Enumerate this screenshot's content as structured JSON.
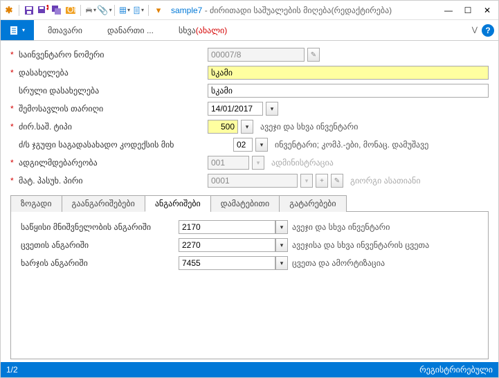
{
  "window": {
    "doc_name": "sample7",
    "title_suffix": " - ძირითადი საშუალების მიღება(რედაქტირება)"
  },
  "menu": {
    "main": "მთავარი",
    "addon": "დანართი ...",
    "other": "სხვა",
    "other_new": "(ახალი)"
  },
  "form": {
    "inv_label": "საინვენტარო ნომერი",
    "inv_value": "00007/8",
    "name_label": "დასახელება",
    "name_value": "სკამი",
    "fullname_label": "სრული დასახელება",
    "fullname_value": "სკამი",
    "date_label": "შემოსავლის თარიღი",
    "date_value": "14/01/2017",
    "type_label": "ძირ.საშ. ტიპი",
    "type_value": "500",
    "type_desc": "ავეჯი და სხვა ინვენტარი",
    "group_label": "ძ/ს ჯგუფი საგადასახადო კოდექსის მიხ",
    "group_value": "02",
    "group_desc": "ინვენტარი; კომპ.-ები, მონაც. დამუშავე",
    "loc_label": "ადგილმდებარეობა",
    "loc_value": "001",
    "loc_desc": "ადმინისტრაცია",
    "resp_label": "მატ. პასუხ. პირი",
    "resp_value": "0001",
    "resp_desc": "გიორგი ასათიანი"
  },
  "tabs": {
    "t1": "ზოგადი",
    "t2": "გაანგარიშებები",
    "t3": "ანგარიშები",
    "t4": "დამატებითი",
    "t5": "გატარებები"
  },
  "accounts": {
    "r1_label": "საწყისი მნიშვნელობის ანგარიში",
    "r1_value": "2170",
    "r1_desc": "ავეჯი და სხვა ინვენტარი",
    "r2_label": "ცვეთის ანგარიში",
    "r2_value": "2270",
    "r2_desc": "ავეჯისა და სხვა ინვენტარის ცვეთა",
    "r3_label": "ხარჯის ანგარიში",
    "r3_value": "7455",
    "r3_desc": "ცვეთა და ამორტიზაცია"
  },
  "status": {
    "page": "1/2",
    "right": "რეგისტრირებული"
  }
}
